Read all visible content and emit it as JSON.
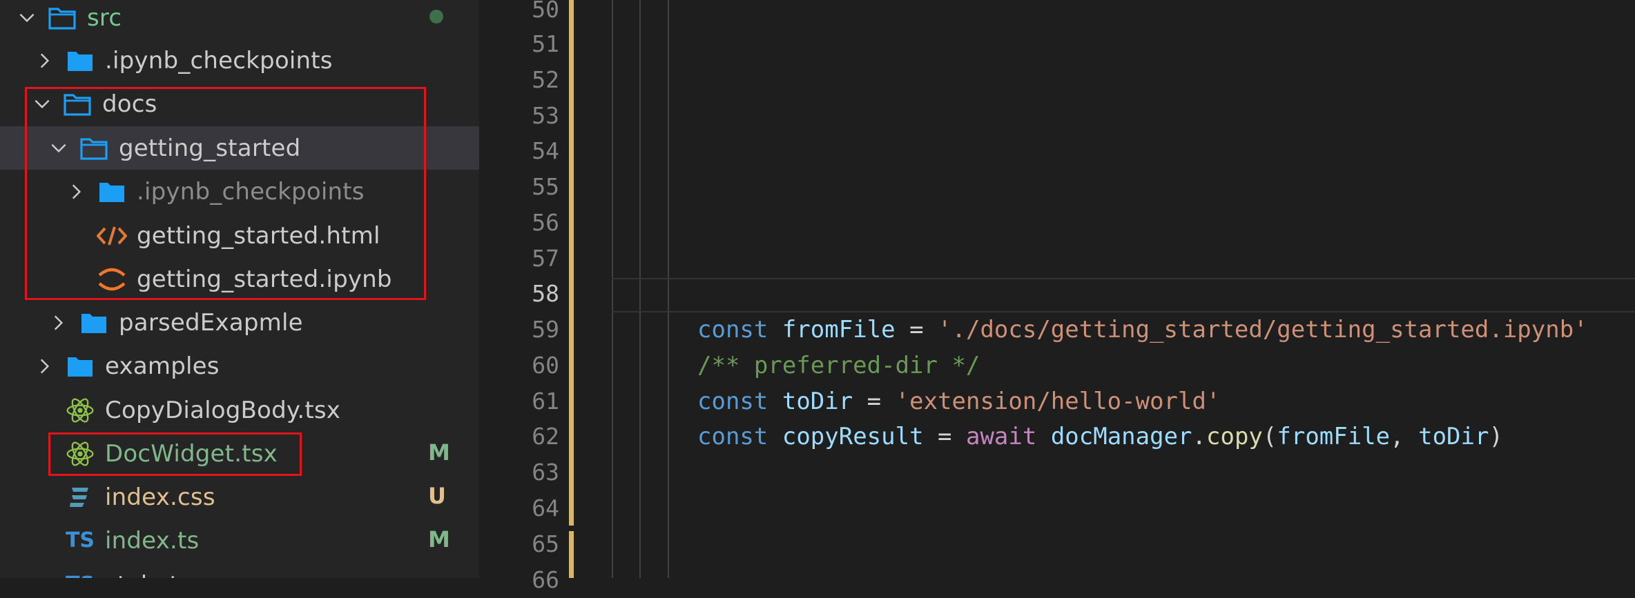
{
  "explorer": {
    "items": [
      {
        "label": "src",
        "badge": ""
      },
      {
        "label": ".ipynb_checkpoints"
      },
      {
        "label": "docs"
      },
      {
        "label": "getting_started"
      },
      {
        "label": ".ipynb_checkpoints"
      },
      {
        "label": "getting_started.html"
      },
      {
        "label": "getting_started.ipynb"
      },
      {
        "label": "parsedExapmle"
      },
      {
        "label": "examples"
      },
      {
        "label": "CopyDialogBody.tsx"
      },
      {
        "label": "DocWidget.tsx",
        "badge": "M"
      },
      {
        "label": "index.css",
        "badge": "U"
      },
      {
        "label": "index.ts",
        "badge": "M"
      },
      {
        "label": "style.ts"
      }
    ]
  },
  "icons": {
    "folder_color": "#1b9ef4",
    "html_icon": "html-code-icon",
    "notebook_icon": "jupyter-icon",
    "react_icon": "react-icon",
    "css_icon": "css-icon",
    "ts_icon": "typescript-icon",
    "ts_text": "TS"
  },
  "colors": {
    "highlight_box": "#e0151b",
    "modified": "#81b88b",
    "untracked": "#e2c08d"
  },
  "editor": {
    "line_numbers": [
      "50",
      "51",
      "52",
      "53",
      "54",
      "55",
      "56",
      "57",
      "58",
      "59",
      "60",
      "61",
      "62",
      "63",
      "64",
      "65",
      "66"
    ],
    "active_line": "58",
    "code": {
      "l59": {
        "kw": "const",
        "name": "fromFile",
        "eq": " = ",
        "value": "'./docs/getting_started/getting_started.ipynb'"
      },
      "l60": {
        "comment": "/** preferred-dir */"
      },
      "l61": {
        "kw": "const",
        "name": "toDir",
        "eq": " = ",
        "value": "'extension/hello-world'"
      },
      "l62": {
        "kw": "const",
        "name": "copyResult",
        "eq": " = ",
        "await": "await",
        "obj": "docManager",
        "dot": ".",
        "fn": "copy",
        "open": "(",
        "arg1": "fromFile",
        "comma": ", ",
        "arg2": "toDir",
        "close": ")"
      }
    }
  }
}
